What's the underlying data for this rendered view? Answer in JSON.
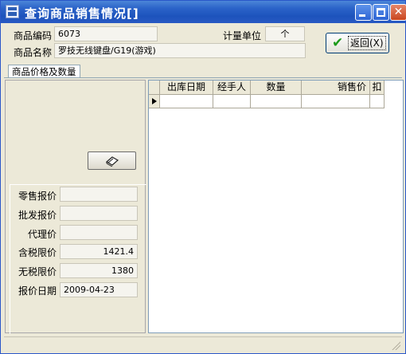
{
  "window": {
    "title": "查询商品销售情况[]"
  },
  "header": {
    "code_label": "商品编码",
    "code_value": "6073",
    "unit_label": "计量单位",
    "unit_value": "个",
    "name_label": "商品名称",
    "name_value": "罗技无线键盘/G19(游戏)",
    "return_button": "返回(X)"
  },
  "tabs": [
    {
      "label": "商品价格及数量",
      "active": true
    }
  ],
  "prices": [
    {
      "label": "零售报价",
      "value": ""
    },
    {
      "label": "批发报价",
      "value": ""
    },
    {
      "label": "代理价",
      "value": ""
    },
    {
      "label": "含税限价",
      "value": "1421.4"
    },
    {
      "label": "无税限价",
      "value": "1380"
    },
    {
      "label": "报价日期",
      "value": "2009-04-23"
    }
  ],
  "grid": {
    "columns": [
      "出库日期",
      "经手人",
      "数量",
      "销售价",
      "扣"
    ],
    "rows": [
      [
        "",
        "",
        "",
        "",
        ""
      ]
    ]
  },
  "icons": {
    "app": "app-icon",
    "action": "eraser-icon",
    "return": "check-icon"
  }
}
